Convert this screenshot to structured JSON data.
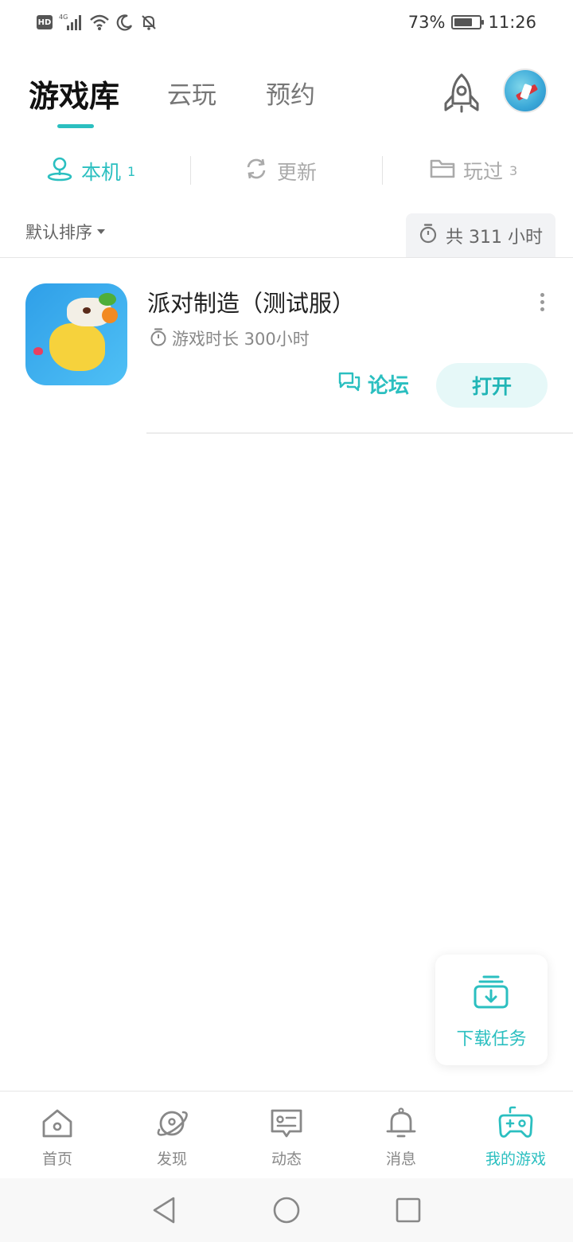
{
  "status_bar": {
    "network_badge": "HD",
    "network_type": "4G",
    "battery_percent": "73%",
    "battery_level": 0.73,
    "time": "11:26"
  },
  "header": {
    "tabs": [
      {
        "label": "游戏库",
        "active": true
      },
      {
        "label": "云玩",
        "active": false
      },
      {
        "label": "预约",
        "active": false
      }
    ],
    "icons": [
      "rocket-icon",
      "avatar"
    ]
  },
  "subtabs": [
    {
      "label": "本机",
      "count": "1",
      "icon": "location-pin-icon",
      "active": true
    },
    {
      "label": "更新",
      "count": "",
      "icon": "refresh-icon",
      "active": false
    },
    {
      "label": "玩过",
      "count": "3",
      "icon": "folder-icon",
      "active": false
    }
  ],
  "sort": {
    "label": "默认排序",
    "total_playtime": "共 311 小时"
  },
  "games": [
    {
      "title": "派对制造（测试服）",
      "playtime": "游戏时长 300小时",
      "forum_label": "论坛",
      "open_label": "打开"
    }
  ],
  "download_task": {
    "label": "下载任务"
  },
  "bottom_nav": [
    {
      "label": "首页",
      "icon": "home-icon",
      "active": false
    },
    {
      "label": "发现",
      "icon": "planet-icon",
      "active": false
    },
    {
      "label": "动态",
      "icon": "message-card-icon",
      "active": false
    },
    {
      "label": "消息",
      "icon": "bell-icon",
      "active": false
    },
    {
      "label": "我的游戏",
      "icon": "gamepad-icon",
      "active": true
    }
  ],
  "colors": {
    "accent": "#2bbfc0",
    "text_primary": "#222222",
    "text_secondary": "#888888"
  }
}
